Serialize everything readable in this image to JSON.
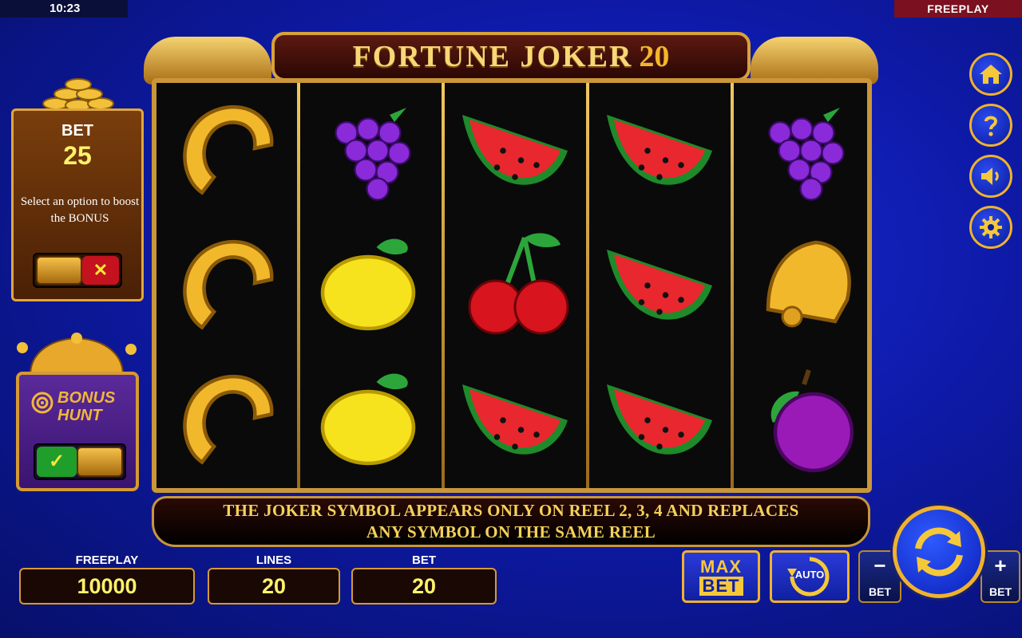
{
  "status_bar": {
    "time": "10:23",
    "mode": "FREEPLAY"
  },
  "title": {
    "main": "FORTUNE JOKER",
    "number": "20"
  },
  "reels": [
    [
      "horseshoe",
      "horseshoe",
      "horseshoe"
    ],
    [
      "grapes",
      "lemon",
      "lemon"
    ],
    [
      "watermelon",
      "cherries",
      "watermelon"
    ],
    [
      "watermelon",
      "watermelon",
      "watermelon"
    ],
    [
      "grapes",
      "bell",
      "plum"
    ]
  ],
  "info_text": {
    "line1": "THE JOKER SYMBOL APPEARS ONLY ON REEL 2, 3, 4 AND REPLACES",
    "line2": "ANY SYMBOL ON THE SAME REEL"
  },
  "bet_panel": {
    "label": "BET",
    "value": "25",
    "hint": "Select an option to boost the BONUS",
    "cancel_symbol": "✕"
  },
  "bonus_hunt": {
    "label_line1": "BONUS",
    "label_line2": "HUNT",
    "confirm_symbol": "✓"
  },
  "stats": {
    "freeplay": {
      "label": "FREEPLAY",
      "value": "10000"
    },
    "lines": {
      "label": "LINES",
      "value": "20"
    },
    "bet": {
      "label": "BET",
      "value": "20"
    }
  },
  "controls": {
    "max_bet_line1": "MAX",
    "max_bet_line2": "BET",
    "auto_label": "AUTO",
    "bet_minus_symbol": "−",
    "bet_plus_symbol": "+",
    "bet_caption": "BET"
  },
  "side_icons": [
    "home-icon",
    "help-icon",
    "sound-icon",
    "settings-icon"
  ],
  "colors": {
    "gold": "#f0b22e",
    "value_yellow": "#fff26a",
    "panel_blue": "#1020a0",
    "background": "#0e1aa8"
  }
}
